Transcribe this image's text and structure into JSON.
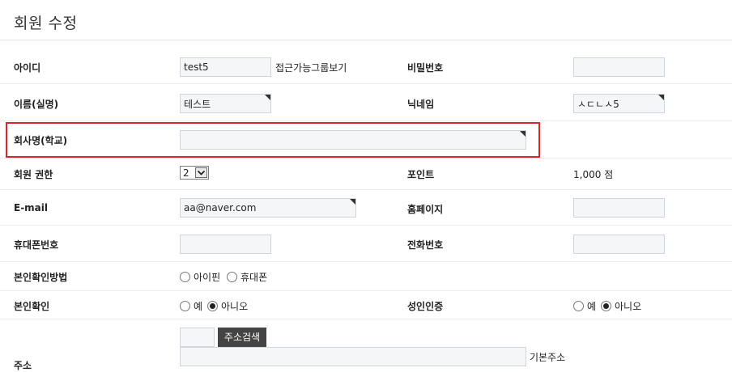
{
  "page": {
    "title": "회원 수정"
  },
  "fields": {
    "user_id": {
      "label": "아이디",
      "value": "test5",
      "extra": "접근가능그룹보기"
    },
    "password": {
      "label": "비밀번호",
      "value": ""
    },
    "name": {
      "label": "이름(실명)",
      "value": "테스트"
    },
    "nickname": {
      "label": "닉네임",
      "value": "ㅅㄷㄴㅅ5"
    },
    "company": {
      "label": "회사명(학교)",
      "value": ""
    },
    "level": {
      "label": "회원 권한",
      "value": "2"
    },
    "points": {
      "label": "포인트",
      "value": "1,000 점"
    },
    "email": {
      "label": "E-mail",
      "value": "aa@naver.com"
    },
    "homepage": {
      "label": "홈페이지",
      "value": ""
    },
    "mobile": {
      "label": "휴대폰번호",
      "value": ""
    },
    "phone": {
      "label": "전화번호",
      "value": ""
    },
    "verify_method": {
      "label": "본인확인방법",
      "options": [
        "아이핀",
        "휴대폰"
      ],
      "selected": null
    },
    "verified": {
      "label": "본인확인",
      "options": [
        "예",
        "아니오"
      ],
      "selected": "아니오"
    },
    "adult": {
      "label": "성인인증",
      "options": [
        "예",
        "아니오"
      ],
      "selected": "아니오"
    },
    "address": {
      "label": "주소",
      "zip": "",
      "search_button": "주소검색",
      "base": "",
      "base_label": "기본주소"
    }
  },
  "colors": {
    "highlight": "#d9262b",
    "button_bg": "#444444",
    "input_bg": "#f4f6f8"
  }
}
